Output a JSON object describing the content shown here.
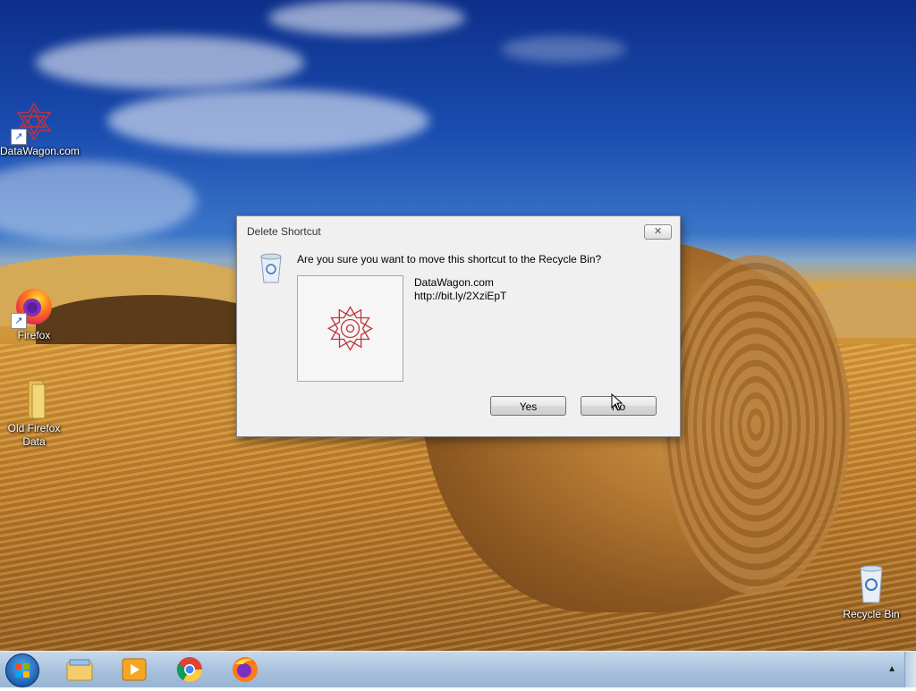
{
  "desktop": {
    "icons": [
      {
        "label": "DataWagon.com",
        "icon": "datawagon-icon",
        "shortcut": true
      },
      {
        "label": "Firefox",
        "icon": "firefox-icon",
        "shortcut": true
      },
      {
        "label": "Old Firefox Data",
        "icon": "folder-icon",
        "shortcut": false
      },
      {
        "label": "Recycle Bin",
        "icon": "recycle-bin-icon",
        "shortcut": false
      }
    ]
  },
  "dialog": {
    "title": "Delete Shortcut",
    "close_label": "✕",
    "question": "Are you sure you want to move this shortcut to the Recycle Bin?",
    "item_name": "DataWagon.com",
    "item_url": "http://bit.ly/2XziEpT",
    "yes_label": "Yes",
    "no_label": "No"
  },
  "taskbar": {
    "pinned": [
      "windows-explorer-icon",
      "media-player-icon",
      "chrome-icon",
      "firefox-icon"
    ],
    "tray_arrow": "▲"
  },
  "colors": {
    "dialog_bg": "#f0f0f0",
    "taskbar": "#a9c2dd",
    "datawagon_red": "#c0343c"
  }
}
